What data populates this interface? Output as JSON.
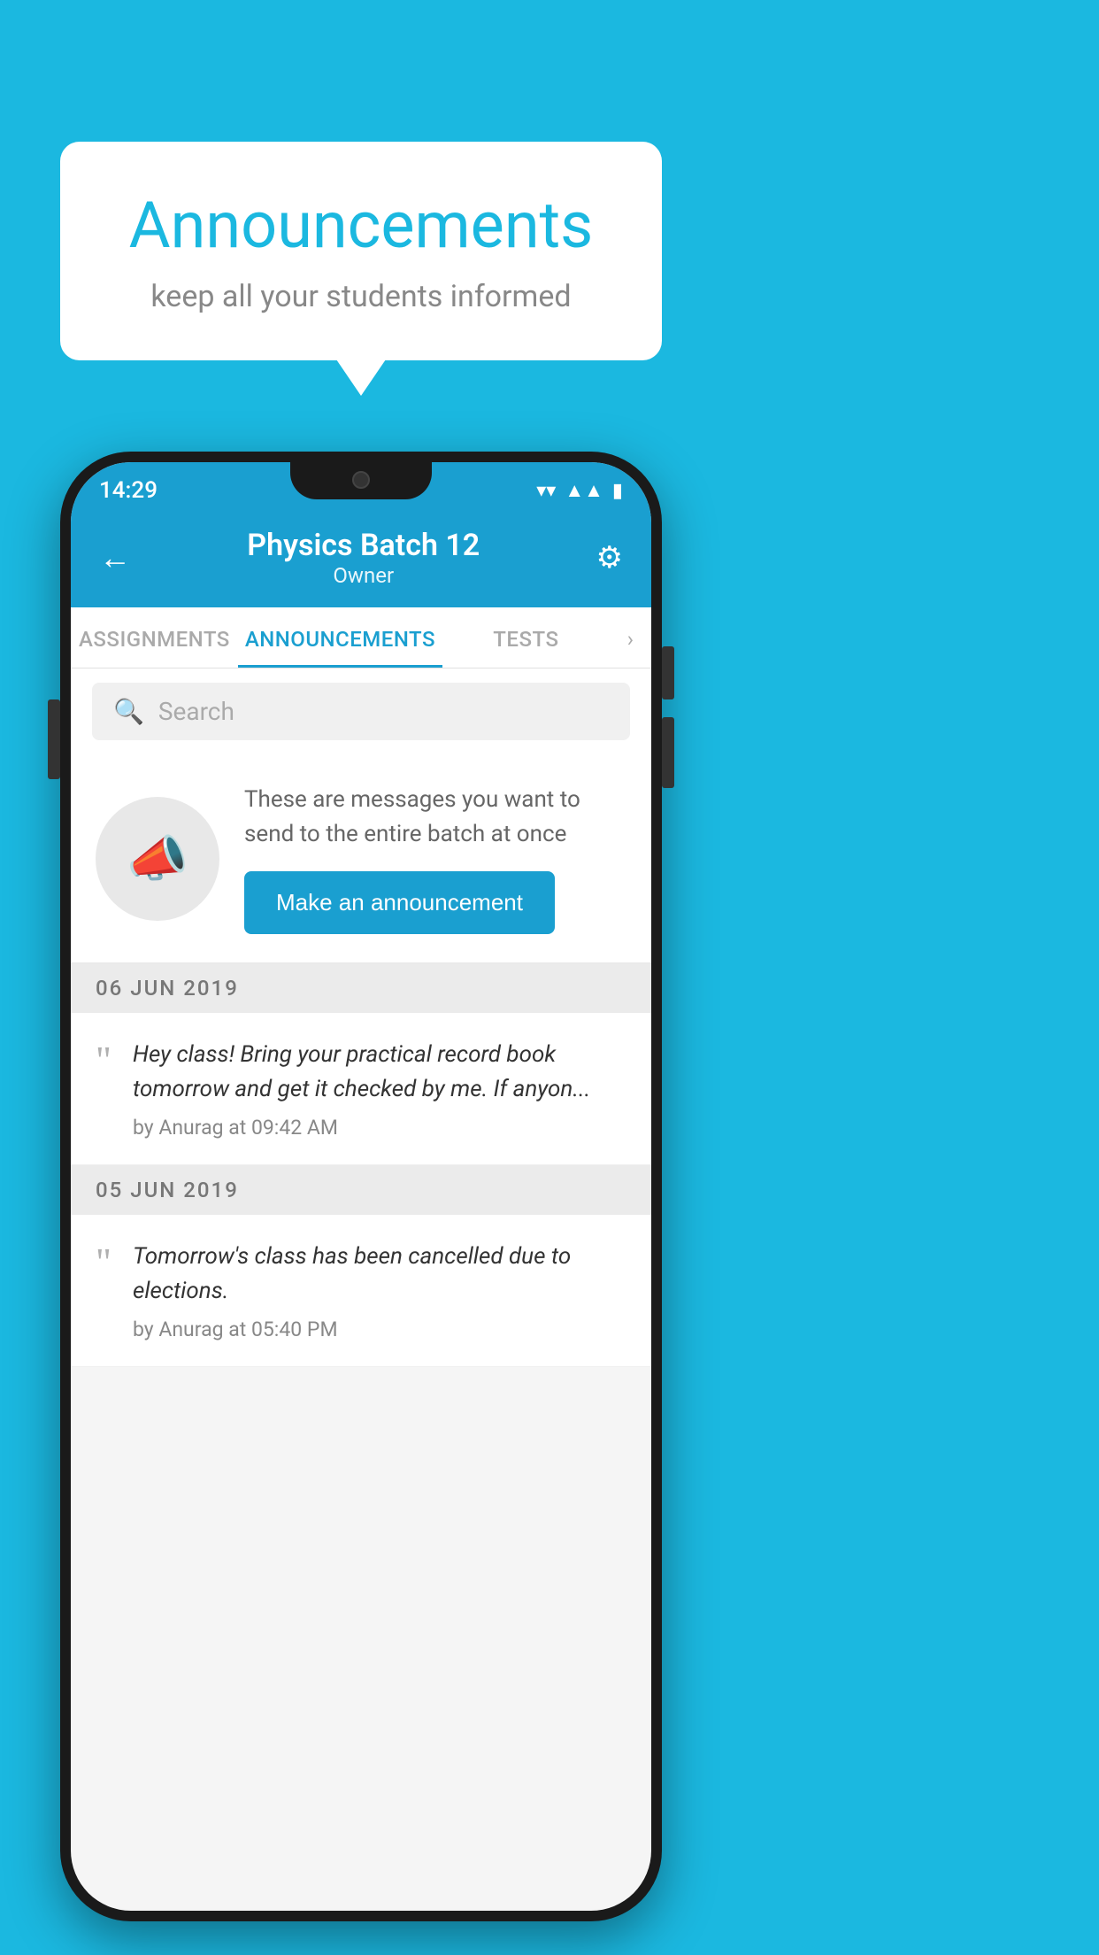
{
  "background_color": "#1bb8e0",
  "bubble": {
    "title": "Announcements",
    "subtitle": "keep all your students informed"
  },
  "phone": {
    "status_bar": {
      "time": "14:29",
      "icons": [
        "wifi",
        "signal",
        "battery"
      ]
    },
    "header": {
      "back_label": "←",
      "title": "Physics Batch 12",
      "subtitle": "Owner",
      "gear_label": "⚙"
    },
    "tabs": [
      {
        "label": "ASSIGNMENTS",
        "active": false
      },
      {
        "label": "ANNOUNCEMENTS",
        "active": true
      },
      {
        "label": "TESTS",
        "active": false
      },
      {
        "label": "›",
        "active": false
      }
    ],
    "search": {
      "placeholder": "Search"
    },
    "announcement_prompt": {
      "description": "These are messages you want to send to the entire batch at once",
      "button_label": "Make an announcement"
    },
    "messages": [
      {
        "date": "06  JUN  2019",
        "text": "Hey class! Bring your practical record book tomorrow and get it checked by me. If anyon...",
        "meta": "by Anurag at 09:42 AM"
      },
      {
        "date": "05  JUN  2019",
        "text": "Tomorrow's class has been cancelled due to elections.",
        "meta": "by Anurag at 05:40 PM"
      }
    ]
  }
}
